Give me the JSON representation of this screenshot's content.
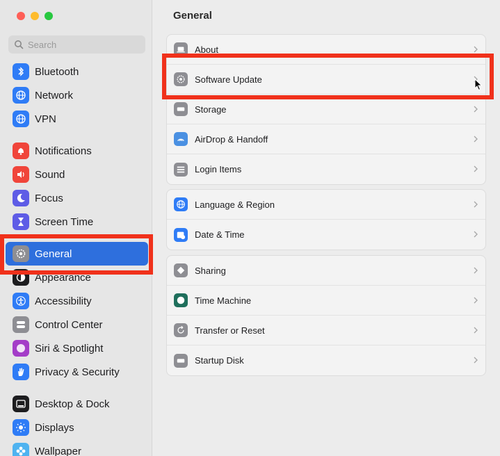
{
  "sidebar": {
    "search_placeholder": "Search",
    "groups": [
      [
        {
          "label": "Bluetooth",
          "icon": "bluetooth-icon",
          "color": "#2f7cf6"
        },
        {
          "label": "Network",
          "icon": "globe-icon",
          "color": "#2f7cf6"
        },
        {
          "label": "VPN",
          "icon": "vpn-globe-icon",
          "color": "#2f7cf6"
        }
      ],
      [
        {
          "label": "Notifications",
          "icon": "bell-icon",
          "color": "#f0453a"
        },
        {
          "label": "Sound",
          "icon": "speaker-icon",
          "color": "#f0453a"
        },
        {
          "label": "Focus",
          "icon": "moon-icon",
          "color": "#5e5ce6"
        },
        {
          "label": "Screen Time",
          "icon": "hourglass-icon",
          "color": "#5e5ce6"
        }
      ],
      [
        {
          "label": "General",
          "icon": "gear-icon",
          "color": "#8e8e93",
          "active": true
        },
        {
          "label": "Appearance",
          "icon": "appearance-icon",
          "color": "#1d1d1f"
        },
        {
          "label": "Accessibility",
          "icon": "accessibility-icon",
          "color": "#2f7cf6"
        },
        {
          "label": "Control Center",
          "icon": "toggles-icon",
          "color": "#8e8e93"
        },
        {
          "label": "Siri & Spotlight",
          "icon": "siri-icon",
          "color": "#a43cc8"
        },
        {
          "label": "Privacy & Security",
          "icon": "hand-icon",
          "color": "#2f7cf6"
        }
      ],
      [
        {
          "label": "Desktop & Dock",
          "icon": "dock-icon",
          "color": "#1d1d1f"
        },
        {
          "label": "Displays",
          "icon": "sun-icon",
          "color": "#2f7cf6"
        },
        {
          "label": "Wallpaper",
          "icon": "flower-icon",
          "color": "#4fb3f0"
        }
      ]
    ]
  },
  "main": {
    "title": "General",
    "groups": [
      [
        {
          "label": "About",
          "icon": "laptop-icon",
          "color": "#8e8e93"
        },
        {
          "label": "Software Update",
          "icon": "gear-icon",
          "color": "#8e8e93"
        },
        {
          "label": "Storage",
          "icon": "drive-icon",
          "color": "#8e8e93"
        },
        {
          "label": "AirDrop & Handoff",
          "icon": "airdrop-icon",
          "color": "#4a90e2"
        },
        {
          "label": "Login Items",
          "icon": "list-icon",
          "color": "#8e8e93"
        }
      ],
      [
        {
          "label": "Language & Region",
          "icon": "globe-icon",
          "color": "#2f7cf6"
        },
        {
          "label": "Date & Time",
          "icon": "calendar-clock-icon",
          "color": "#2f7cf6"
        }
      ],
      [
        {
          "label": "Sharing",
          "icon": "sharing-icon",
          "color": "#8e8e93"
        },
        {
          "label": "Time Machine",
          "icon": "time-machine-icon",
          "color": "#1f6f5c"
        },
        {
          "label": "Transfer or Reset",
          "icon": "reset-icon",
          "color": "#8e8e93"
        },
        {
          "label": "Startup Disk",
          "icon": "disk-icon",
          "color": "#8e8e93"
        }
      ]
    ]
  },
  "annotation_color": "#f0311b"
}
